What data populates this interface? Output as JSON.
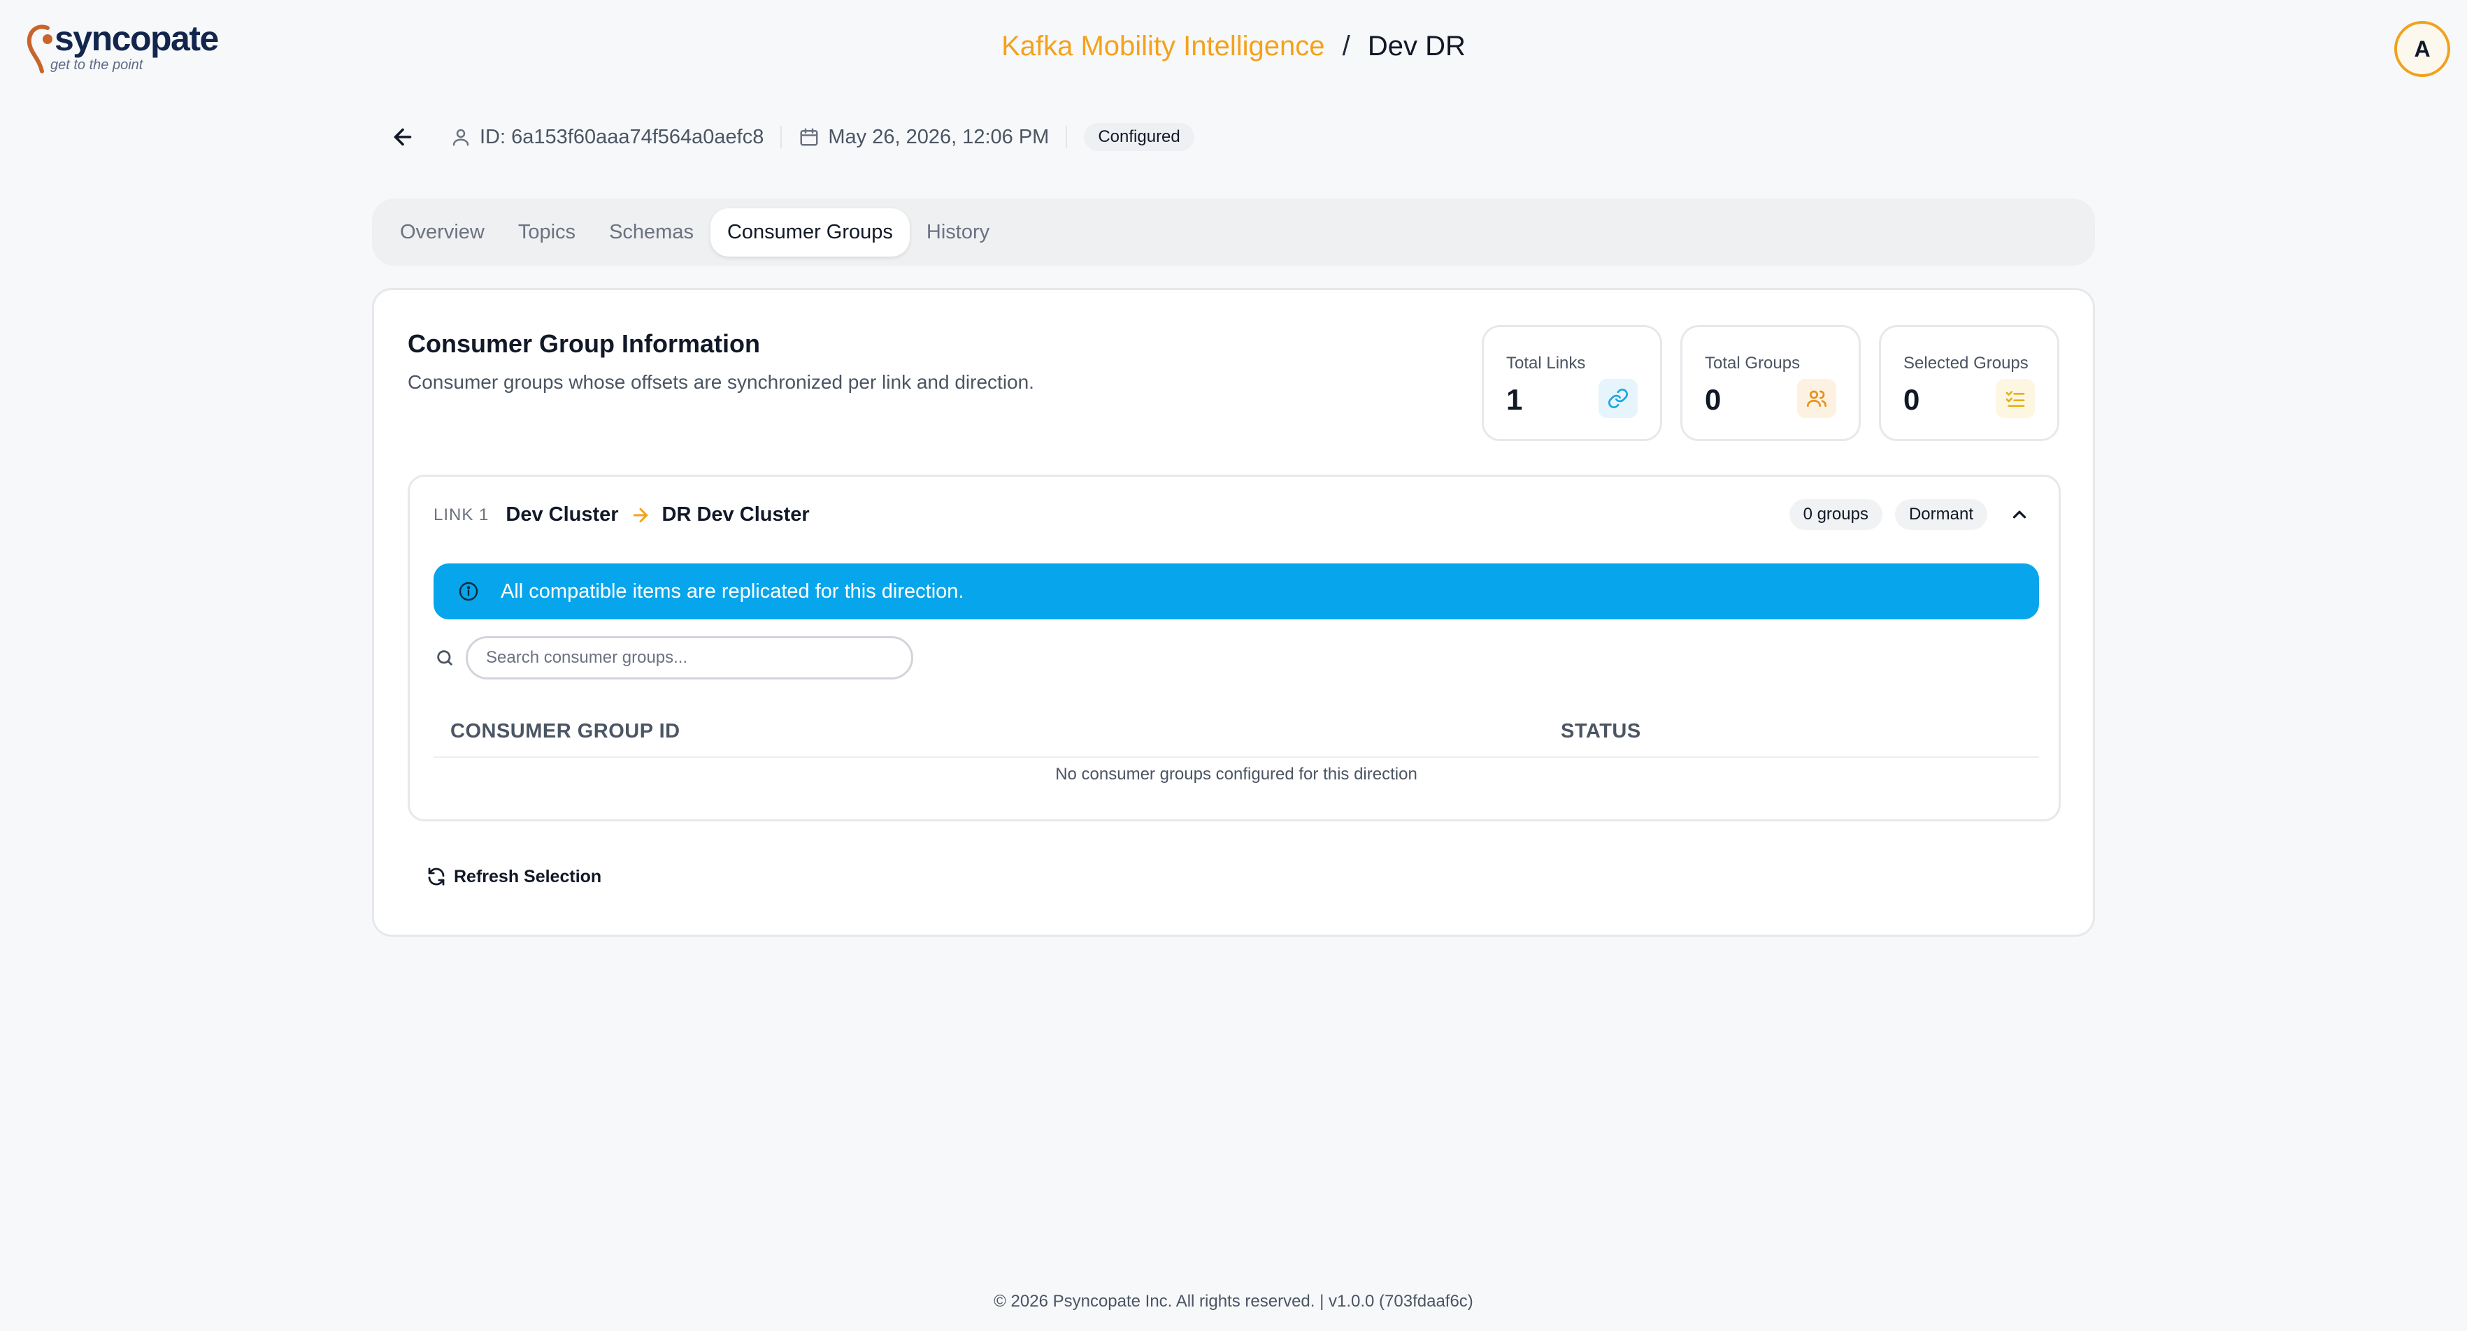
{
  "brand": {
    "name": "syncopate",
    "tagline": "get to the point"
  },
  "header": {
    "project": "Kafka Mobility Intelligence",
    "separator": "/",
    "environment": "Dev DR",
    "avatar_initial": "A"
  },
  "meta": {
    "id_text": "ID: 6a153f60aaa74f564a0aefc8",
    "date_text": "May 26, 2026, 12:06 PM",
    "status_badge": "Configured"
  },
  "tabs": [
    {
      "label": "Overview",
      "active": false
    },
    {
      "label": "Topics",
      "active": false
    },
    {
      "label": "Schemas",
      "active": false
    },
    {
      "label": "Consumer Groups",
      "active": true
    },
    {
      "label": "History",
      "active": false
    }
  ],
  "card": {
    "title": "Consumer Group Information",
    "subtitle": "Consumer groups whose offsets are synchronized per link and direction."
  },
  "stats": [
    {
      "label": "Total Links",
      "value": "1",
      "icon": "link-icon",
      "color": "#1aa6e0",
      "bg": "#e6f5fc"
    },
    {
      "label": "Total Groups",
      "value": "0",
      "icon": "users-icon",
      "color": "#e6901a",
      "bg": "#fdf2e1"
    },
    {
      "label": "Selected Groups",
      "value": "0",
      "icon": "list-check-icon",
      "color": "#e6b11a",
      "bg": "#fdf6e1"
    }
  ],
  "link": {
    "tag": "LINK 1",
    "source": "Dev Cluster",
    "target": "DR Dev Cluster",
    "groups_count": "0 groups",
    "state": "Dormant",
    "info_message": "All compatible items are replicated for this direction.",
    "search_placeholder": "Search consumer groups...",
    "columns": [
      "CONSUMER GROUP ID",
      "STATUS"
    ],
    "empty_message": "No consumer groups configured for this direction"
  },
  "actions": {
    "refresh_label": "Refresh Selection"
  },
  "footer": {
    "text": "© 2026 Psyncopate Inc. All rights reserved. | v1.0.0 (703fdaaf6c)"
  },
  "colors": {
    "accent": "#f4a21a",
    "info": "#07a5eb",
    "brand_navy": "#12264d"
  }
}
